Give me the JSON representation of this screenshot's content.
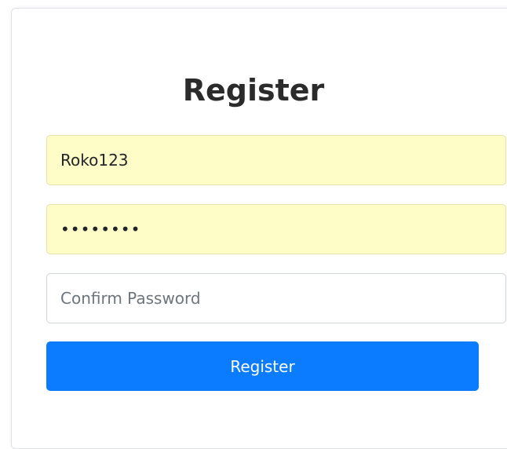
{
  "form": {
    "title": "Register",
    "username_value": "Roko123",
    "password_value": "password",
    "confirm_placeholder": "Confirm Password",
    "submit_label": "Register"
  },
  "colors": {
    "autofill_background": "#fefcc7",
    "primary_button": "#0b7bff",
    "title_text": "#2b2b2b"
  }
}
